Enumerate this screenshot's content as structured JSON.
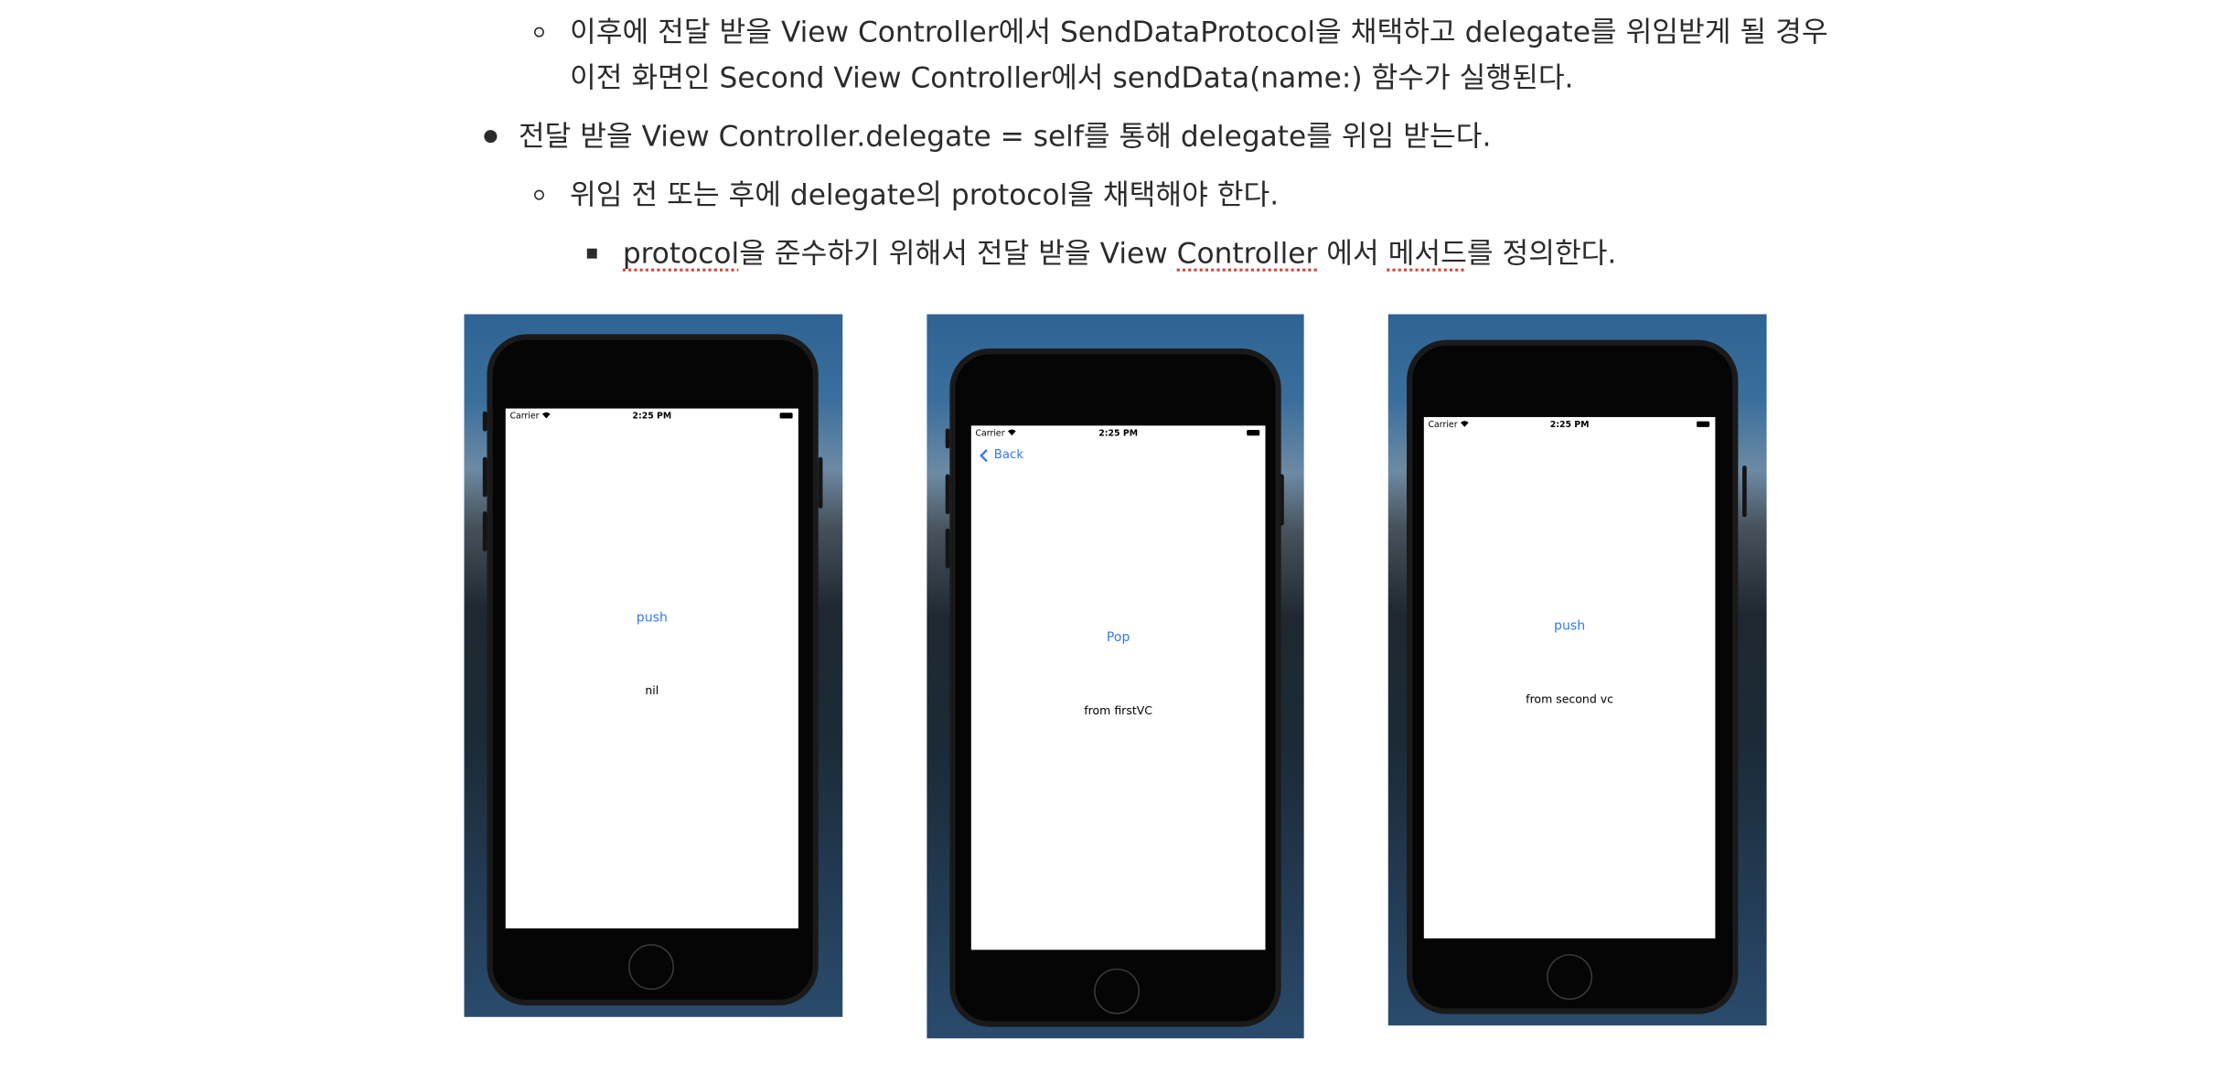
{
  "document": {
    "lines": [
      {
        "bullet": "circle",
        "text": "이후에 전달 받을 View Controller에서 SendDataProtocol을 채택하고 delegate를 위임받게 될 경우"
      },
      {
        "bullet": "none",
        "text": "이전 화면인 Second View Controller에서 sendData(name:) 함수가 실행된다."
      },
      {
        "bullet": "disc",
        "text": "전달 받을 View Controller.delegate = self를 통해 delegate를 위임 받는다."
      },
      {
        "bullet": "circle",
        "text": "위임 전 또는 후에 delegate의 protocol을 채택해야 한다."
      },
      {
        "bullet": "square",
        "segments": [
          "protocol",
          "을 준수하기 위해서 전달 받을 View ",
          "Controller",
          " 에서 ",
          "메서드",
          "를 정의한다."
        ]
      }
    ]
  },
  "screenshots": [
    {
      "carrier": "Carrier",
      "time": "2:25 PM",
      "button": "push",
      "label": "nil"
    },
    {
      "carrier": "Carrier",
      "time": "2:25 PM",
      "back": "Back",
      "button": "Pop",
      "label": "from firstVC"
    },
    {
      "carrier": "Carrier",
      "time": "2:25 PM",
      "button": "push",
      "label": "from second vc"
    }
  ],
  "icons": {
    "wifi": "wifi-icon",
    "battery": "battery-icon",
    "back_chevron": "chevron-left-icon",
    "home": "home-button-icon"
  },
  "colors": {
    "text": "#2b2b2b",
    "ios_tint": "#3478f6",
    "spell_underline": "#d4453b"
  }
}
